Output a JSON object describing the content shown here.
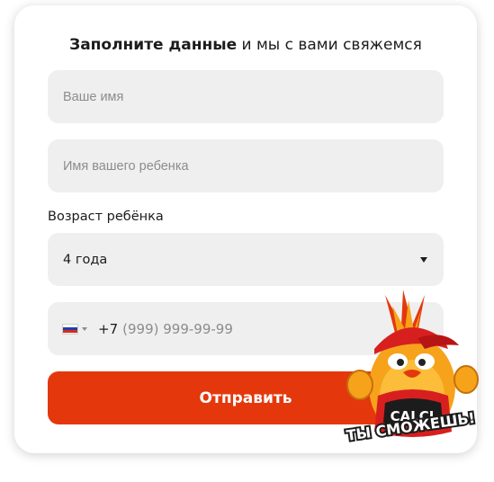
{
  "form": {
    "title_bold": "Заполните данные",
    "title_rest": " и мы с вами свяжемся",
    "name_placeholder": "Ваше имя",
    "child_placeholder": "Имя вашего ребенка",
    "age_label": "Возраст ребёнка",
    "age_selected": "4 года",
    "phone_code": "+7",
    "phone_mask": "(999) 999-99-99",
    "submit_label": "Отправить"
  },
  "mascot": {
    "cap_text": "CALCI",
    "slogan": "ТЫ СМОЖЕШЬ!"
  },
  "colors": {
    "accent": "#e4380c",
    "field_bg": "#efefef"
  }
}
